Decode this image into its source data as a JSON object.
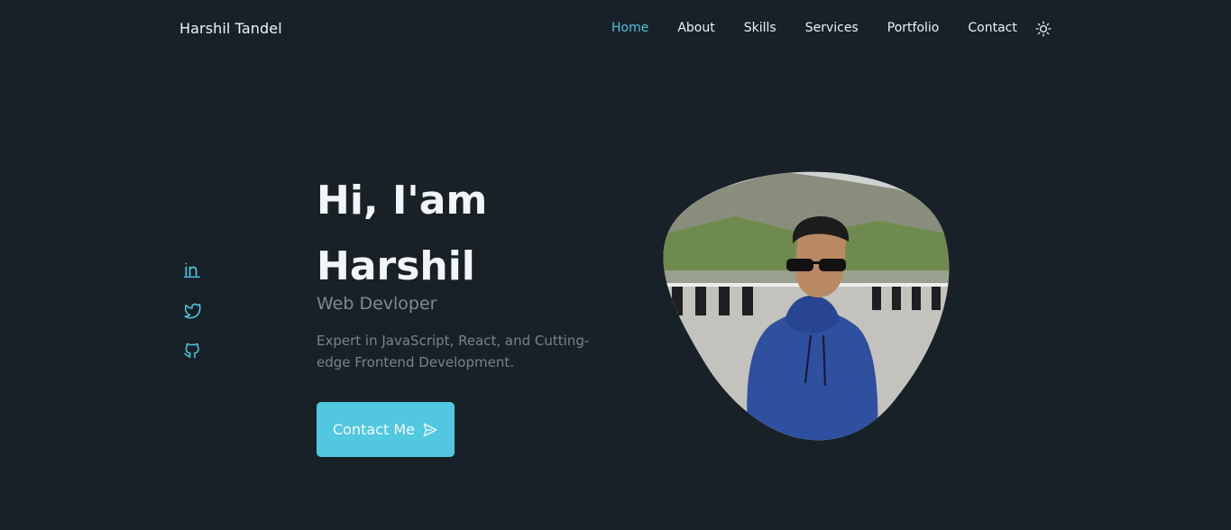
{
  "nav": {
    "logo": "Harshil Tandel",
    "links": [
      "Home",
      "About",
      "Skills",
      "Services",
      "Portfolio",
      "Contact"
    ],
    "active": "Home",
    "theme_icon": "sun-icon"
  },
  "socials": [
    "linkedin-icon",
    "twitter-icon",
    "github-icon"
  ],
  "hero": {
    "greeting_line1": "Hi, I'am",
    "greeting_line2": "Harshil",
    "subtitle": "Web Devloper",
    "description": "Expert in JavaScript, React, and Cutting-edge Frontend Development.",
    "cta_label": "Contact Me",
    "cta_icon": "send-icon"
  },
  "colors": {
    "background": "#172127",
    "accent": "#4fc3df",
    "button": "#52c7e0",
    "muted_text": "#76858c"
  }
}
